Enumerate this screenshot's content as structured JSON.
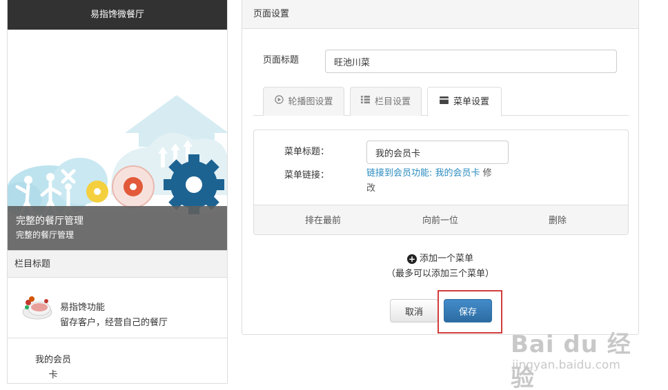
{
  "preview": {
    "header_title": "易指馋微餐厅",
    "banner": {
      "title": "完整的餐厅管理",
      "subtitle": "完整的餐厅管理"
    },
    "section_title": "栏目标题",
    "feature": {
      "name": "易指馋功能",
      "desc": "留存客户，经营自己的餐厅"
    },
    "menu_item_label_line1": "我的会员",
    "menu_item_label_line2": "卡"
  },
  "panel": {
    "header": "页面设置",
    "page_title_label": "页面标题",
    "page_title_value": "旺池川菜",
    "tabs": [
      {
        "label": "轮播图设置",
        "icon": "play-circle-icon",
        "active": false
      },
      {
        "label": "栏目设置",
        "icon": "list-icon",
        "active": false
      },
      {
        "label": "菜单设置",
        "icon": "card-icon",
        "active": true
      }
    ],
    "menu_card": {
      "title_label": "菜单标题：",
      "title_value": "我的会员卡",
      "link_label": "菜单链接：",
      "link_text": "链接到会员功能: 我的会员卡",
      "edit_line1": " 修",
      "edit_line2": "改",
      "actions": [
        "排在最前",
        "向前一位",
        "删除"
      ]
    },
    "add_menu": "添加一个菜单",
    "add_hint": "（最多可以添加三个菜单）",
    "cancel_label": "取消",
    "save_label": "保存"
  },
  "watermark": {
    "logo": "Bai du 经验",
    "url": "jingyan.baidu.com"
  },
  "colors": {
    "header_dark": "#323232",
    "link_blue": "#2a8bbf",
    "primary_button": "#428bca",
    "highlight_red": "#d23b3b"
  }
}
